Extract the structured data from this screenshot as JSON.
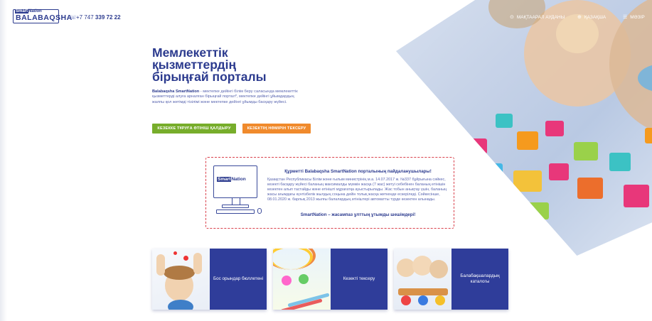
{
  "header": {
    "logo_top_a": "Smart",
    "logo_top_b": "Nation",
    "logo_word": "BALABAQSHA",
    "phone_prefix": "+7 747 ",
    "phone_main": "339 72 22",
    "nav": [
      {
        "label": "МАҚТААРАЛ АУДАНЫ",
        "icon": "location-pin-icon"
      },
      {
        "label": "ҚАЗАҚША",
        "icon": "globe-icon"
      },
      {
        "label": "МӘЗІР",
        "icon": "menu-icon"
      }
    ]
  },
  "hero": {
    "title_1": "Мемлекеттік",
    "title_2": "қызметтердің",
    "title_3": "бірыңғай порталы",
    "desc_bold": "Balabaqsha SmartNation",
    "desc_rest": " - мектепке дейінгі білім беру саласында мемлекеттік қызметтерді алуға арналған бірыңғай портал*, мектепке дейінгі ұйымдардың жалпы қол жетімді тізілімі және мектепке дейінгі ұйымды басқару жүйесі.",
    "btn_queue": "КЕЗЕККЕ ТҰРУҒА ӨТІНІШ ҚАЛДЫРУ",
    "btn_check": "КЕЗЕКТІҢ НӨМІРІН ТЕКСЕРУ"
  },
  "notice": {
    "brand_a": "Smart",
    "brand_b": "Nation",
    "title": "Құрметті Balabaqsha SmartNation порталының пайдаланушылары!",
    "body": "Қазақстан Республикасы Білім және ғылым министрінің м.а. 14.07.2017 ж. №337 бұйрығына сәйкес, кезекті басқару жүйесі баланың максималды мүмкін жасқа (7 жас) жетуі себебінен баланың өтінішін кезектен алып тастайды және өтінішті мұрағатқа ауыстырылады. Жас тобын анықтау үшін, баланың жасы ағымдағы күнтізбелік жылдың соңына дейін толық жасқа жеткенде ескеріледі. Сәйкесінше, 08.01.2020 ж. барлық 2013 жылғы балалардың өтініштері автоматты түрде кезектен алынады.",
    "footer": "SmartNation – жасампаз ұлттың ұтымды шешімдері!"
  },
  "cards": [
    {
      "label": "Бос орындар бюллетені"
    },
    {
      "label": "Кезекті тексеру"
    },
    {
      "label": "Балабақшалардың каталогы"
    }
  ],
  "colors": {
    "brand_blue": "#2b3a8e",
    "card_blue": "#2f3d9a",
    "green": "#77ad2b",
    "orange": "#f08a2c",
    "notice_border": "#d9404b"
  }
}
